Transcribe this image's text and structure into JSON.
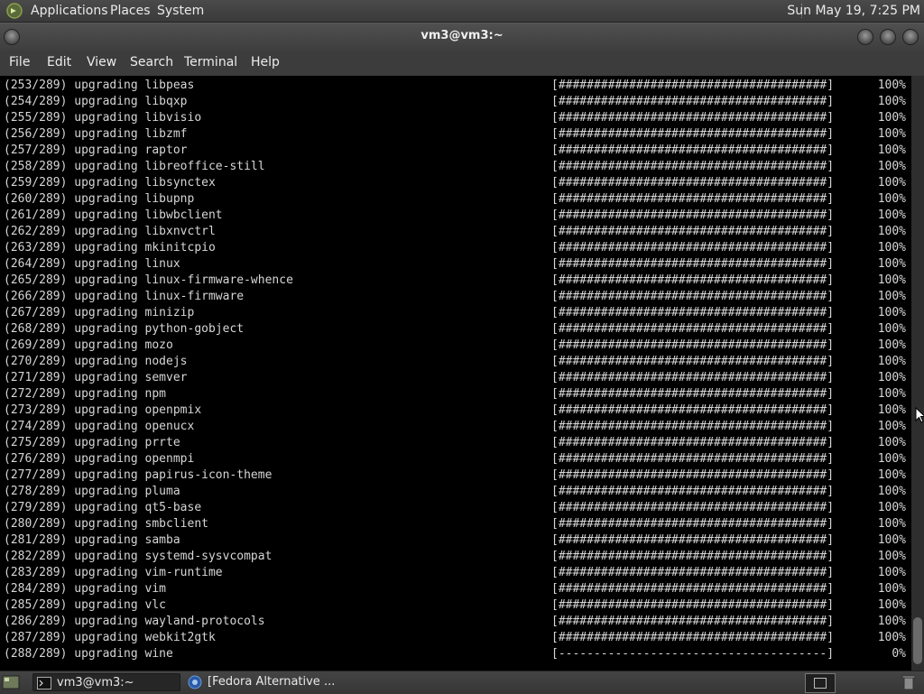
{
  "top_panel": {
    "menus": [
      "Applications",
      "Places",
      "System"
    ],
    "clock": "Sun May 19,  7:25 PM"
  },
  "window": {
    "title": "vm3@vm3:~"
  },
  "menubar": [
    "File",
    "Edit",
    "View",
    "Search",
    "Terminal",
    "Help"
  ],
  "terminal": {
    "lines": [
      {
        "label": "(253/289) upgrading libpeas",
        "bar": "[######################################]",
        "percent": "100%"
      },
      {
        "label": "(254/289) upgrading libqxp",
        "bar": "[######################################]",
        "percent": "100%"
      },
      {
        "label": "(255/289) upgrading libvisio",
        "bar": "[######################################]",
        "percent": "100%"
      },
      {
        "label": "(256/289) upgrading libzmf",
        "bar": "[######################################]",
        "percent": "100%"
      },
      {
        "label": "(257/289) upgrading raptor",
        "bar": "[######################################]",
        "percent": "100%"
      },
      {
        "label": "(258/289) upgrading libreoffice-still",
        "bar": "[######################################]",
        "percent": "100%"
      },
      {
        "label": "(259/289) upgrading libsynctex",
        "bar": "[######################################]",
        "percent": "100%"
      },
      {
        "label": "(260/289) upgrading libupnp",
        "bar": "[######################################]",
        "percent": "100%"
      },
      {
        "label": "(261/289) upgrading libwbclient",
        "bar": "[######################################]",
        "percent": "100%"
      },
      {
        "label": "(262/289) upgrading libxnvctrl",
        "bar": "[######################################]",
        "percent": "100%"
      },
      {
        "label": "(263/289) upgrading mkinitcpio",
        "bar": "[######################################]",
        "percent": "100%"
      },
      {
        "label": "(264/289) upgrading linux",
        "bar": "[######################################]",
        "percent": "100%"
      },
      {
        "label": "(265/289) upgrading linux-firmware-whence",
        "bar": "[######################################]",
        "percent": "100%"
      },
      {
        "label": "(266/289) upgrading linux-firmware",
        "bar": "[######################################]",
        "percent": "100%"
      },
      {
        "label": "(267/289) upgrading minizip",
        "bar": "[######################################]",
        "percent": "100%"
      },
      {
        "label": "(268/289) upgrading python-gobject",
        "bar": "[######################################]",
        "percent": "100%"
      },
      {
        "label": "(269/289) upgrading mozo",
        "bar": "[######################################]",
        "percent": "100%"
      },
      {
        "label": "(270/289) upgrading nodejs",
        "bar": "[######################################]",
        "percent": "100%"
      },
      {
        "label": "(271/289) upgrading semver",
        "bar": "[######################################]",
        "percent": "100%"
      },
      {
        "label": "(272/289) upgrading npm",
        "bar": "[######################################]",
        "percent": "100%"
      },
      {
        "label": "(273/289) upgrading openpmix",
        "bar": "[######################################]",
        "percent": "100%"
      },
      {
        "label": "(274/289) upgrading openucx",
        "bar": "[######################################]",
        "percent": "100%"
      },
      {
        "label": "(275/289) upgrading prrte",
        "bar": "[######################################]",
        "percent": "100%"
      },
      {
        "label": "(276/289) upgrading openmpi",
        "bar": "[######################################]",
        "percent": "100%"
      },
      {
        "label": "(277/289) upgrading papirus-icon-theme",
        "bar": "[######################################]",
        "percent": "100%"
      },
      {
        "label": "(278/289) upgrading pluma",
        "bar": "[######################################]",
        "percent": "100%"
      },
      {
        "label": "(279/289) upgrading qt5-base",
        "bar": "[######################################]",
        "percent": "100%"
      },
      {
        "label": "(280/289) upgrading smbclient",
        "bar": "[######################################]",
        "percent": "100%"
      },
      {
        "label": "(281/289) upgrading samba",
        "bar": "[######################################]",
        "percent": "100%"
      },
      {
        "label": "(282/289) upgrading systemd-sysvcompat",
        "bar": "[######################################]",
        "percent": "100%"
      },
      {
        "label": "(283/289) upgrading vim-runtime",
        "bar": "[######################################]",
        "percent": "100%"
      },
      {
        "label": "(284/289) upgrading vim",
        "bar": "[######################################]",
        "percent": "100%"
      },
      {
        "label": "(285/289) upgrading vlc",
        "bar": "[######################################]",
        "percent": "100%"
      },
      {
        "label": "(286/289) upgrading wayland-protocols",
        "bar": "[######################################]",
        "percent": "100%"
      },
      {
        "label": "(287/289) upgrading webkit2gtk",
        "bar": "[######################################]",
        "percent": "100%"
      },
      {
        "label": "(288/289) upgrading wine",
        "bar": "[--------------------------------------]",
        "percent": "0%"
      }
    ]
  },
  "taskbar": {
    "tasks": [
      "vm3@vm3:~",
      "[Fedora Alternative ..."
    ]
  },
  "icons": {
    "app_menu": "mate-logo-icon",
    "show_desktop": "show-desktop-icon",
    "terminal_task": "terminal-icon",
    "browser_task": "browser-icon",
    "trash": "trash-icon"
  },
  "colors": {
    "terminal_bg": "#000000",
    "terminal_fg": "#d6d6d6",
    "panel_bg": "#3c3c3c"
  }
}
